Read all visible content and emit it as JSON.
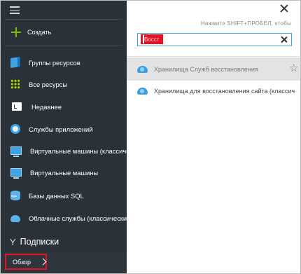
{
  "sidebar": {
    "create_label": "Создать",
    "items": [
      {
        "label": "Группы ресурсов",
        "icon": "resource-groups-icon"
      },
      {
        "label": "Все ресурсы",
        "icon": "all-resources-icon"
      },
      {
        "label": "Недавнее",
        "icon": "recent-icon"
      },
      {
        "label": "Службы приложений",
        "icon": "app-services-icon"
      },
      {
        "label": "Виртуальные машины (классические)",
        "icon": "vm-classic-icon"
      },
      {
        "label": "Виртуальные машины",
        "icon": "vm-icon"
      },
      {
        "label": "Базы данных SQL",
        "icon": "sql-db-icon"
      },
      {
        "label": "Облачные службы (классические)",
        "icon": "cloud-services-icon"
      }
    ],
    "subscriptions_label": "Подписки",
    "browse_label": "Обзор"
  },
  "panel": {
    "hint": "Нажмите SHIFT+ПРОБЕЛ, чтобы",
    "search": {
      "value": "Восст",
      "placeholder": ""
    },
    "results": [
      {
        "label": "Хранилища Служб восстановления",
        "highlighted": true
      },
      {
        "label": "Хранилища для восстановления сайта (классич",
        "highlighted": false
      }
    ]
  },
  "colors": {
    "sidebar_bg": "#2b3138",
    "accent_green": "#7fba00",
    "accent_blue": "#41a6dc",
    "highlight_red": "#e81123"
  }
}
